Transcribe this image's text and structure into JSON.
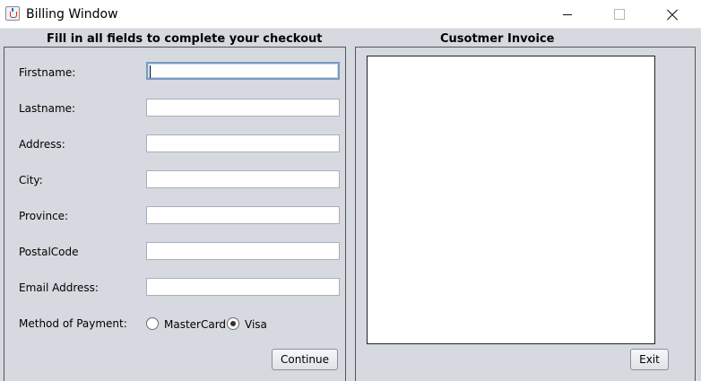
{
  "window": {
    "title": "Billing Window",
    "icon": "java-cup-icon"
  },
  "left_panel": {
    "heading": "Fill in all fields to complete your checkout",
    "fields": [
      {
        "label": "Firstname:",
        "value": ""
      },
      {
        "label": "Lastname:",
        "value": ""
      },
      {
        "label": "Address:",
        "value": ""
      },
      {
        "label": "City:",
        "value": ""
      },
      {
        "label": "Province:",
        "value": ""
      },
      {
        "label": "PostalCode",
        "value": ""
      },
      {
        "label": "Email Address:",
        "value": ""
      }
    ],
    "payment": {
      "label": "Method of Payment:",
      "options": [
        "MasterCard",
        "Visa"
      ],
      "selected": "Visa"
    },
    "continue_label": "Continue"
  },
  "right_panel": {
    "heading": "Cusotmer Invoice",
    "invoice_text": "",
    "exit_label": "Exit"
  }
}
